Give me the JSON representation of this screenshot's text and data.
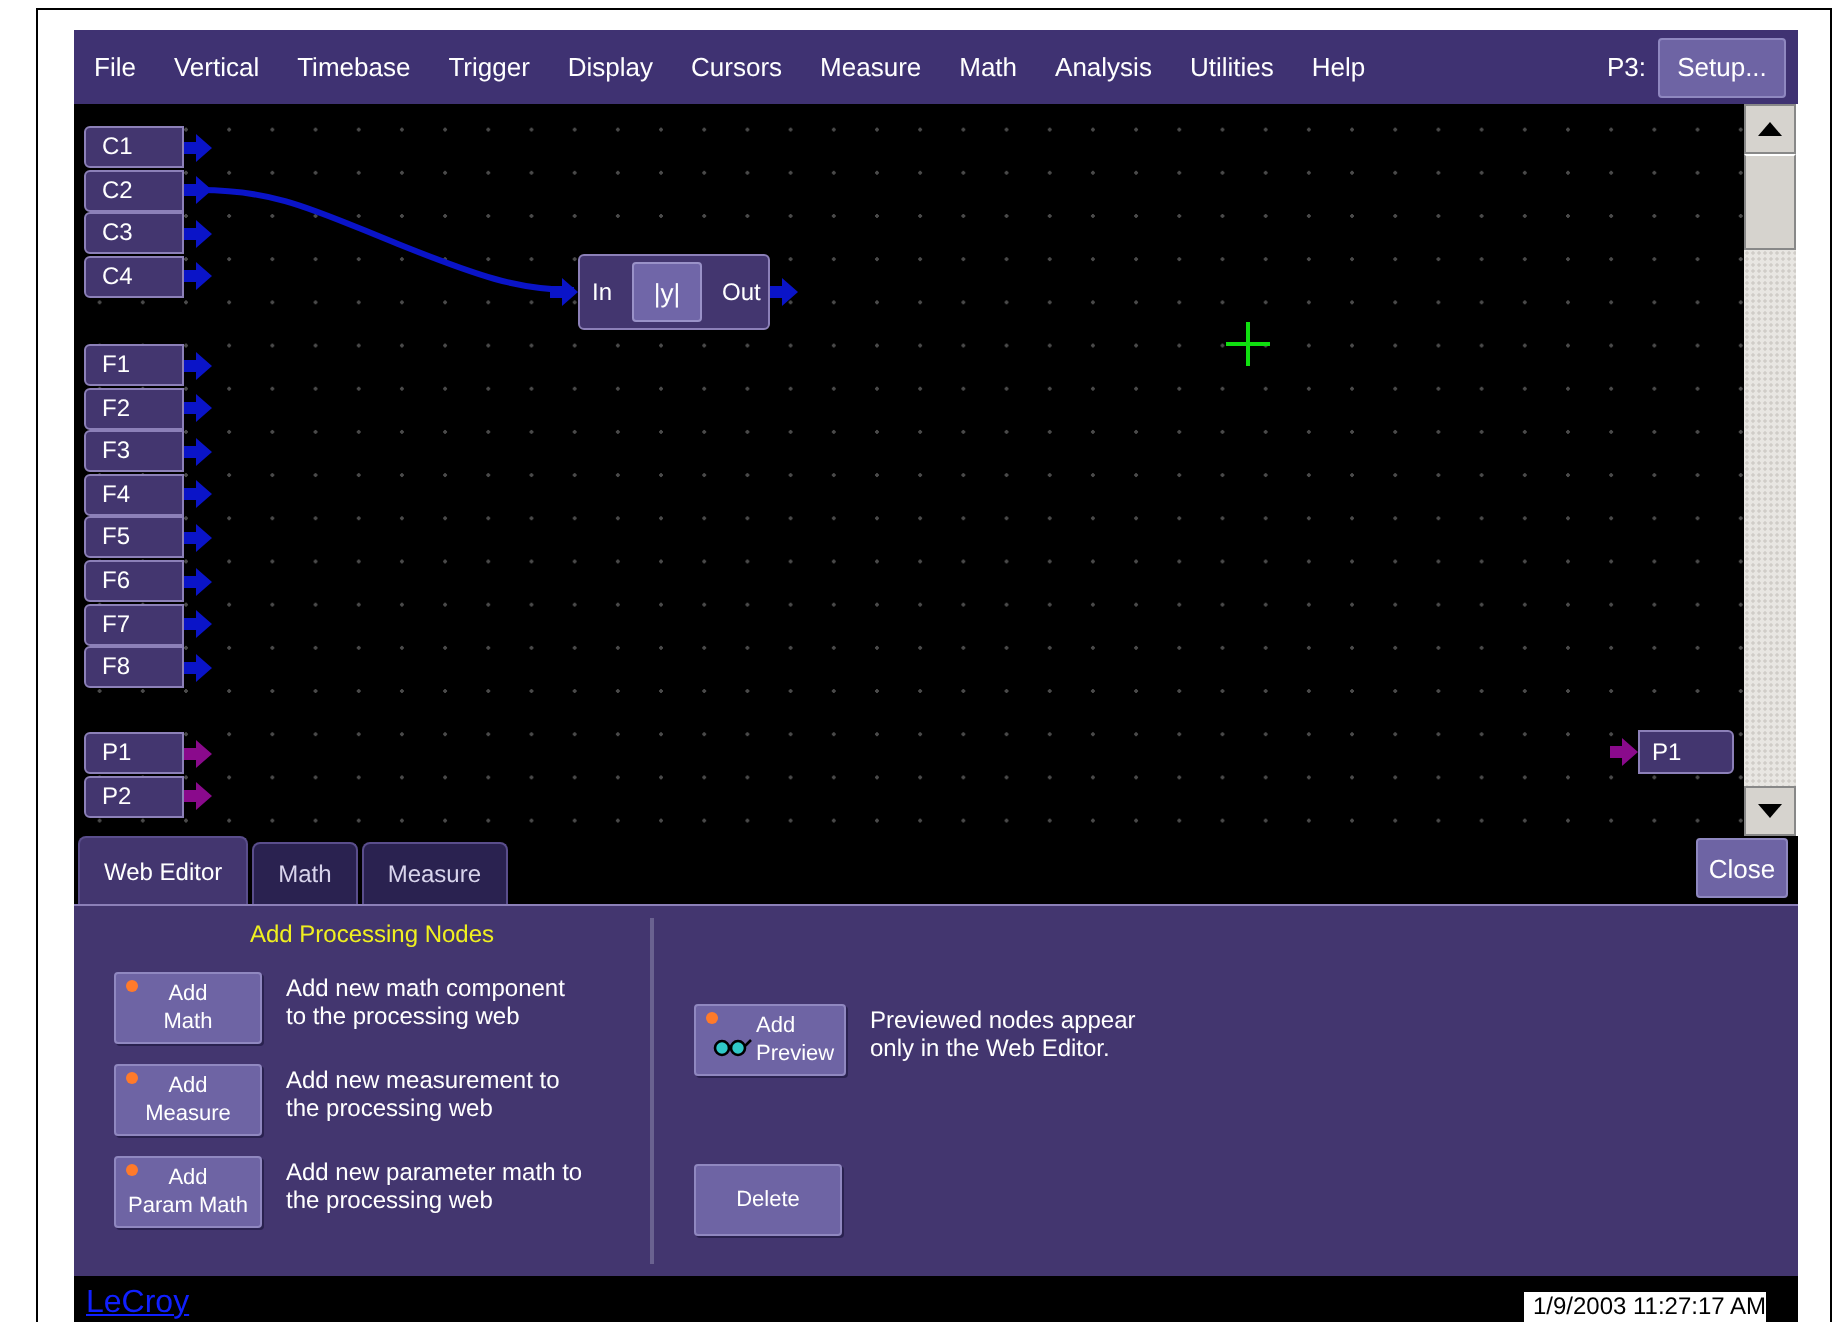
{
  "menu_bar": {
    "items": [
      "File",
      "Vertical",
      "Timebase",
      "Trigger",
      "Display",
      "Cursors",
      "Measure",
      "Math",
      "Analysis",
      "Utilities",
      "Help"
    ],
    "context_label": "P3:",
    "setup_button": "Setup..."
  },
  "canvas": {
    "source_groups": [
      {
        "nodes": [
          {
            "label": "C1",
            "color": "#0a14c8"
          },
          {
            "label": "C2",
            "color": "#0a14c8"
          },
          {
            "label": "C3",
            "color": "#0a14c8"
          },
          {
            "label": "C4",
            "color": "#0a14c8"
          }
        ]
      },
      {
        "nodes": [
          {
            "label": "F1",
            "color": "#0a14c8"
          },
          {
            "label": "F2",
            "color": "#0a14c8"
          },
          {
            "label": "F3",
            "color": "#0a14c8"
          },
          {
            "label": "F4",
            "color": "#0a14c8"
          },
          {
            "label": "F5",
            "color": "#0a14c8"
          },
          {
            "label": "F6",
            "color": "#0a14c8"
          },
          {
            "label": "F7",
            "color": "#0a14c8"
          },
          {
            "label": "F8",
            "color": "#0a14c8"
          }
        ]
      },
      {
        "nodes": [
          {
            "label": "P1",
            "color": "#8a0a8c"
          },
          {
            "label": "P2",
            "color": "#8a0a8c"
          }
        ]
      }
    ],
    "function_node": {
      "input": "In",
      "operation": "|y|",
      "output": "Out"
    },
    "output_node": {
      "label": "P1",
      "color": "#8a0a8c"
    }
  },
  "tabs": [
    {
      "label": "Web Editor",
      "selected": true
    },
    {
      "label": "Math",
      "selected": false
    },
    {
      "label": "Measure",
      "selected": false
    }
  ],
  "close_button": "Close",
  "panel": {
    "heading": "Add Processing Nodes",
    "add_buttons": [
      {
        "lines": [
          "Add",
          "Math"
        ],
        "indicator": true,
        "description": "Add new math component to the processing web"
      },
      {
        "lines": [
          "Add",
          "Measure"
        ],
        "indicator": true,
        "description": "Add new measurement to the processing web"
      },
      {
        "lines": [
          "Add",
          "Param Math"
        ],
        "indicator": true,
        "description": "Add new parameter math to the processing web"
      }
    ],
    "preview_button": {
      "lines": [
        "Add",
        "Preview"
      ],
      "indicator": true,
      "description": "Previewed nodes appear only in the Web Editor."
    },
    "delete_button": {
      "lines": [
        "Delete"
      ]
    }
  },
  "footer": {
    "brand": "LeCroy",
    "timestamp": "1/9/2003 11:27:17 AM"
  }
}
